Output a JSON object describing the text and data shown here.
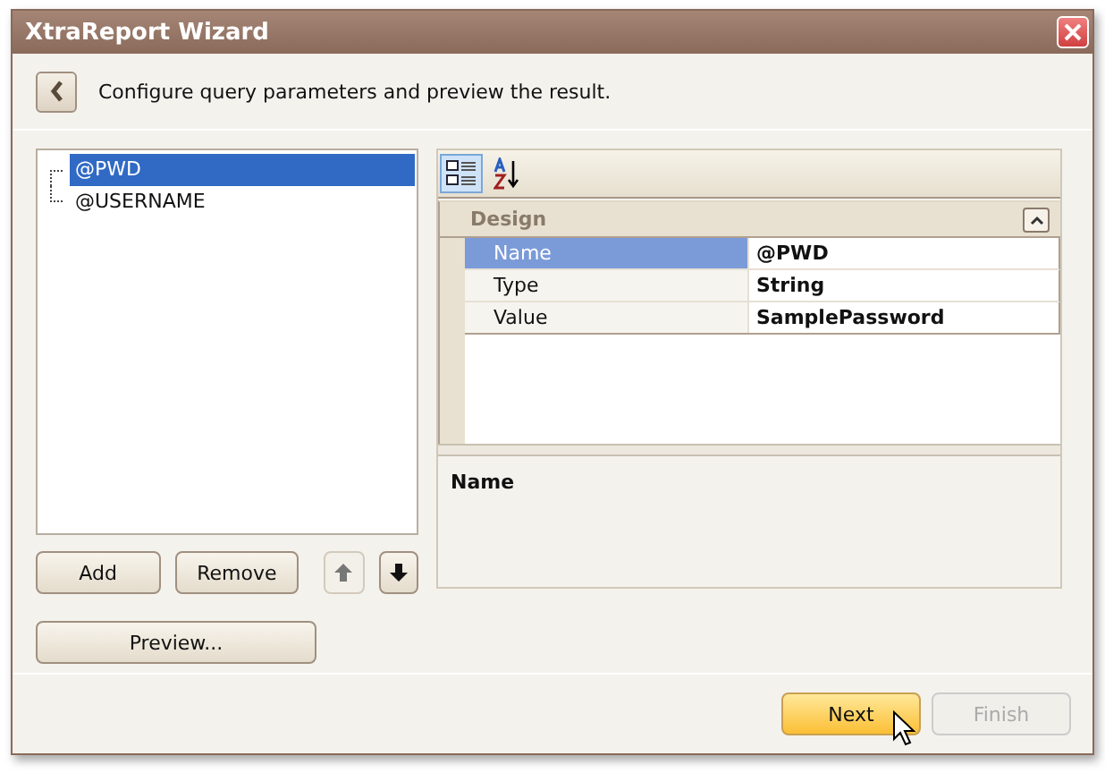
{
  "window": {
    "title": "XtraReport Wizard"
  },
  "header": {
    "text": "Configure query parameters and preview the result."
  },
  "parameters": [
    {
      "label": "@PWD",
      "selected": true
    },
    {
      "label": "@USERNAME",
      "selected": false
    }
  ],
  "list_buttons": [
    {
      "kind": "text",
      "label": "Add",
      "disabled": false
    },
    {
      "kind": "text",
      "label": "Remove",
      "disabled": false
    },
    {
      "kind": "up",
      "disabled": true
    },
    {
      "kind": "down",
      "disabled": false
    }
  ],
  "preview_button": {
    "label": "Preview..."
  },
  "property_toolbar": [
    {
      "kind": "categorized",
      "selected": true
    },
    {
      "kind": "alphabetical",
      "selected": false
    }
  ],
  "property_grid": {
    "category": "Design",
    "expanded": true,
    "rows": [
      {
        "name": "Name",
        "value": "@PWD",
        "selected": true
      },
      {
        "name": "Type",
        "value": "String",
        "selected": false
      },
      {
        "name": "Value",
        "value": "SamplePassword",
        "selected": false
      }
    ]
  },
  "description": {
    "title": "Name"
  },
  "footer_buttons": [
    {
      "label": "Next",
      "hot": true,
      "disabled": false
    },
    {
      "label": "Finish",
      "hot": false,
      "disabled": true
    }
  ]
}
